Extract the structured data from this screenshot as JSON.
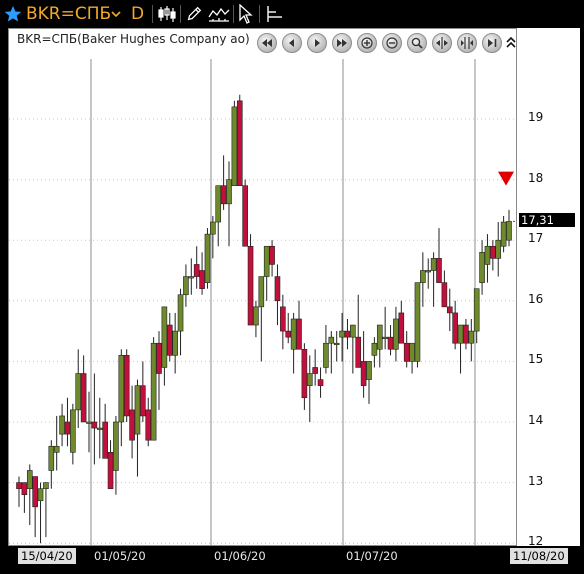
{
  "toolbar": {
    "symbol": "BKR=СПБ",
    "period": "D"
  },
  "chart": {
    "instrument_title": "BKR=СПБ(Baker Hughes Company ао)",
    "last_price_label": "17,31",
    "last_price_value": 17.31,
    "dates": {
      "start_box": "15/04/20",
      "end_box": "11/08/20",
      "months": [
        "01/05/20",
        "01/06/20",
        "01/07/20"
      ]
    },
    "price_ticks": [
      "19",
      "18",
      "17",
      "16",
      "15",
      "14",
      "13",
      "12"
    ],
    "colors": {
      "up": "#6f8a2c",
      "down": "#c0103c",
      "marker": "#e10000"
    }
  },
  "chart_data": {
    "type": "candlestick",
    "ylim": [
      12,
      19.9
    ],
    "x_start": "15/04/20",
    "x_end": "11/08/20",
    "candles": [
      [
        13.0,
        13.1,
        12.6,
        12.9
      ],
      [
        13.0,
        13.0,
        12.5,
        12.8
      ],
      [
        12.9,
        13.3,
        12.3,
        13.2
      ],
      [
        13.1,
        13.1,
        12.1,
        12.6
      ],
      [
        12.7,
        13.0,
        12.0,
        12.9
      ],
      [
        12.9,
        13.0,
        12.1,
        13.0
      ],
      [
        13.2,
        13.7,
        12.9,
        13.6
      ],
      [
        13.5,
        14.1,
        13.2,
        13.6
      ],
      [
        13.8,
        14.3,
        13.6,
        14.1
      ],
      [
        14.0,
        14.4,
        13.6,
        13.8
      ],
      [
        13.5,
        14.3,
        13.3,
        14.2
      ],
      [
        14.2,
        15.2,
        13.9,
        14.8
      ],
      [
        14.8,
        15.1,
        14.1,
        14.0
      ],
      [
        14.0,
        14.5,
        13.5,
        14.0
      ],
      [
        14.0,
        14.8,
        13.3,
        13.9
      ],
      [
        13.9,
        14.4,
        13.4,
        13.9
      ],
      [
        14.0,
        14.3,
        13.4,
        13.4
      ],
      [
        13.5,
        13.7,
        12.9,
        12.9
      ],
      [
        13.2,
        14.1,
        12.8,
        14.0
      ],
      [
        14.0,
        15.2,
        13.6,
        15.1
      ],
      [
        15.1,
        15.2,
        14.0,
        14.1
      ],
      [
        14.2,
        14.6,
        13.4,
        13.7
      ],
      [
        13.8,
        14.7,
        13.1,
        14.6
      ],
      [
        14.6,
        15.0,
        14.0,
        14.1
      ],
      [
        14.2,
        14.4,
        13.6,
        13.7
      ],
      [
        13.7,
        15.4,
        13.7,
        15.3
      ],
      [
        15.3,
        15.5,
        14.2,
        14.8
      ],
      [
        14.9,
        15.9,
        14.6,
        15.9
      ],
      [
        15.6,
        15.8,
        15.0,
        15.1
      ],
      [
        15.1,
        15.8,
        14.8,
        15.5
      ],
      [
        15.5,
        16.2,
        15.1,
        16.1
      ],
      [
        16.1,
        16.6,
        15.9,
        16.4
      ],
      [
        16.4,
        16.7,
        16.1,
        16.4
      ],
      [
        16.6,
        16.9,
        16.2,
        16.4
      ],
      [
        16.5,
        16.8,
        16.1,
        16.2
      ],
      [
        16.3,
        17.2,
        16.2,
        17.1
      ],
      [
        17.1,
        17.4,
        16.7,
        17.3
      ],
      [
        17.3,
        17.9,
        16.9,
        17.9
      ],
      [
        17.9,
        18.4,
        17.5,
        17.6
      ],
      [
        17.6,
        18.3,
        16.9,
        18.0
      ],
      [
        17.9,
        19.3,
        17.9,
        19.2
      ],
      [
        19.3,
        19.4,
        17.9,
        17.9
      ],
      [
        17.9,
        18.0,
        16.9,
        16.9
      ],
      [
        16.9,
        17.1,
        15.7,
        15.6
      ],
      [
        15.6,
        16.0,
        15.4,
        15.9
      ],
      [
        15.9,
        16.4,
        15.0,
        16.4
      ],
      [
        16.4,
        16.9,
        16.0,
        16.9
      ],
      [
        16.9,
        17.0,
        16.4,
        16.6
      ],
      [
        16.4,
        16.6,
        15.6,
        16.0
      ],
      [
        15.9,
        16.1,
        15.2,
        15.5
      ],
      [
        15.5,
        15.8,
        15.3,
        15.4
      ],
      [
        15.2,
        15.8,
        14.8,
        15.7
      ],
      [
        15.7,
        16.0,
        15.2,
        15.2
      ],
      [
        15.2,
        15.3,
        14.2,
        14.4
      ],
      [
        14.6,
        15.1,
        14.0,
        14.8
      ],
      [
        14.9,
        15.2,
        14.6,
        14.8
      ],
      [
        14.7,
        14.9,
        14.4,
        14.6
      ],
      [
        14.9,
        15.6,
        14.8,
        15.3
      ],
      [
        15.3,
        15.5,
        14.8,
        15.4
      ],
      [
        15.3,
        15.5,
        15.0,
        15.3
      ],
      [
        15.4,
        15.8,
        15.0,
        15.5
      ],
      [
        15.5,
        15.7,
        15.2,
        15.4
      ],
      [
        15.4,
        15.6,
        14.8,
        15.6
      ],
      [
        15.4,
        16.1,
        14.9,
        14.9
      ],
      [
        15.0,
        15.5,
        14.4,
        14.6
      ],
      [
        14.7,
        15.0,
        14.3,
        15.0
      ],
      [
        15.1,
        15.4,
        14.9,
        15.3
      ],
      [
        15.2,
        15.6,
        14.9,
        15.6
      ],
      [
        15.4,
        15.9,
        15.2,
        15.4
      ],
      [
        15.4,
        15.6,
        15.1,
        15.2
      ],
      [
        15.2,
        15.9,
        15.0,
        15.7
      ],
      [
        15.8,
        16.0,
        15.3,
        15.3
      ],
      [
        15.3,
        15.5,
        14.9,
        15.0
      ],
      [
        15.0,
        15.3,
        14.8,
        15.3
      ],
      [
        15.0,
        16.3,
        14.9,
        16.3
      ],
      [
        16.3,
        16.8,
        15.9,
        16.5
      ],
      [
        16.5,
        16.7,
        16.2,
        16.5
      ],
      [
        16.5,
        16.8,
        15.9,
        16.7
      ],
      [
        16.7,
        17.2,
        16.3,
        16.3
      ],
      [
        16.3,
        16.5,
        15.9,
        15.9
      ],
      [
        15.9,
        16.2,
        15.5,
        15.8
      ],
      [
        15.8,
        16.0,
        15.2,
        15.3
      ],
      [
        15.3,
        15.5,
        14.8,
        15.6
      ],
      [
        15.6,
        15.7,
        15.2,
        15.3
      ],
      [
        15.3,
        15.7,
        15.0,
        15.5
      ],
      [
        15.5,
        16.2,
        15.3,
        16.2
      ],
      [
        16.3,
        17.0,
        16.1,
        16.8
      ],
      [
        16.6,
        17.1,
        16.3,
        16.9
      ],
      [
        16.9,
        17.0,
        16.5,
        16.7
      ],
      [
        16.7,
        17.3,
        16.4,
        17.0
      ],
      [
        16.9,
        17.4,
        16.8,
        17.3
      ],
      [
        17.0,
        17.5,
        16.9,
        17.31
      ]
    ]
  }
}
